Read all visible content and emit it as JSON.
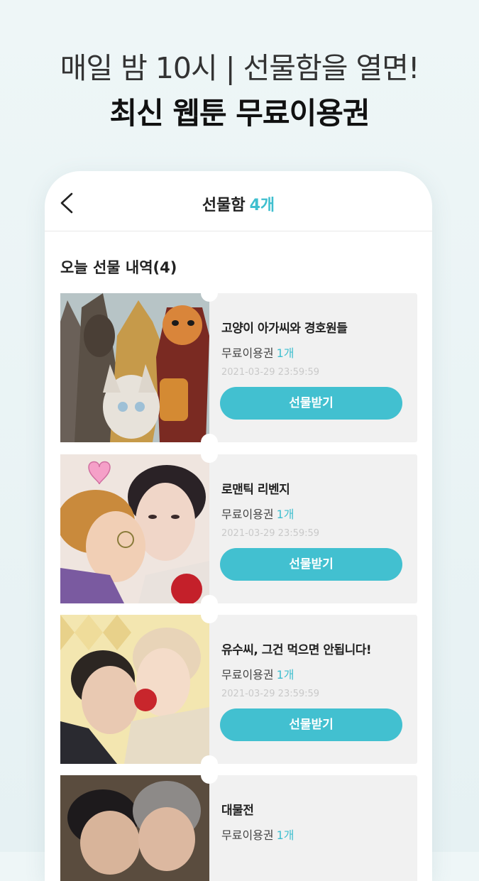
{
  "promo": {
    "line1": "매일 밤 10시 | 선물함을 열면!",
    "line2": "최신 웹툰 무료이용권"
  },
  "header": {
    "title": "선물함",
    "count": "4개",
    "back_icon": "chevron-left-icon"
  },
  "section": {
    "title": "오늘 선물 내역(4)"
  },
  "colors": {
    "accent": "#42c0d0",
    "accent_text": "#3fbfcf",
    "card_bg": "#f1f1f1"
  },
  "gifts": [
    {
      "title": "고양이 아가씨와 경호원들",
      "ticket_label": "무료이용권",
      "ticket_qty": "1개",
      "date": "2021-03-29 23:59:59",
      "button": "선물받기"
    },
    {
      "title": "로맨틱 리벤지",
      "ticket_label": "무료이용권",
      "ticket_qty": "1개",
      "date": "2021-03-29 23:59:59",
      "button": "선물받기"
    },
    {
      "title": "유수씨, 그건 먹으면 안됩니다!",
      "ticket_label": "무료이용권",
      "ticket_qty": "1개",
      "date": "2021-03-29 23:59:59",
      "button": "선물받기"
    },
    {
      "title": "대물전",
      "ticket_label": "무료이용권",
      "ticket_qty": "1개",
      "date": "",
      "button": ""
    }
  ]
}
